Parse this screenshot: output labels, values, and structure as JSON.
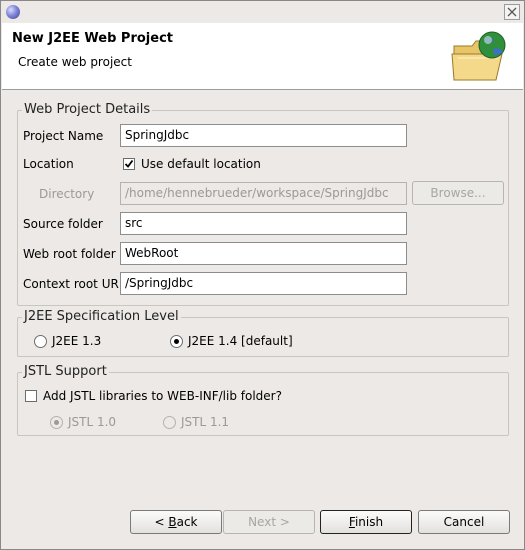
{
  "window": {
    "close_icon": "close-icon"
  },
  "banner": {
    "title": "New J2EE Web Project",
    "description": "Create web project",
    "icon": "folder-globe-icon"
  },
  "web_project_details": {
    "legend": "Web Project Details",
    "project_name": {
      "label": "Project Name",
      "value": "SpringJdbc"
    },
    "location": {
      "label": "Location",
      "checkbox_label": "Use default location",
      "checked": true
    },
    "directory": {
      "label": "Directory",
      "value": "/home/hennebrueder/workspace/SpringJdbc",
      "browse_label": "Browse..."
    },
    "source_folder": {
      "label": "Source folder",
      "value": "src"
    },
    "web_root_folder": {
      "label": "Web root folder",
      "value": "WebRoot"
    },
    "context_root_url": {
      "label": "Context root URL",
      "value": "/SpringJdbc"
    }
  },
  "j2ee_spec": {
    "legend": "J2EE Specification Level",
    "options": [
      {
        "label": "J2EE 1.3",
        "selected": false
      },
      {
        "label": "J2EE 1.4 [default]",
        "selected": true
      }
    ]
  },
  "jstl_support": {
    "legend": "JSTL Support",
    "checkbox_label": "Add JSTL libraries to WEB-INF/lib folder?",
    "checked": false,
    "options": [
      {
        "label": "JSTL 1.0",
        "selected": true,
        "enabled": false
      },
      {
        "label": "JSTL 1.1",
        "selected": false,
        "enabled": false
      }
    ]
  },
  "buttons": {
    "back": {
      "prefix": "< ",
      "mnemonic": "B",
      "rest": "ack"
    },
    "next": "Next >",
    "finish": {
      "mnemonic": "F",
      "rest": "inish"
    },
    "cancel": "Cancel"
  }
}
